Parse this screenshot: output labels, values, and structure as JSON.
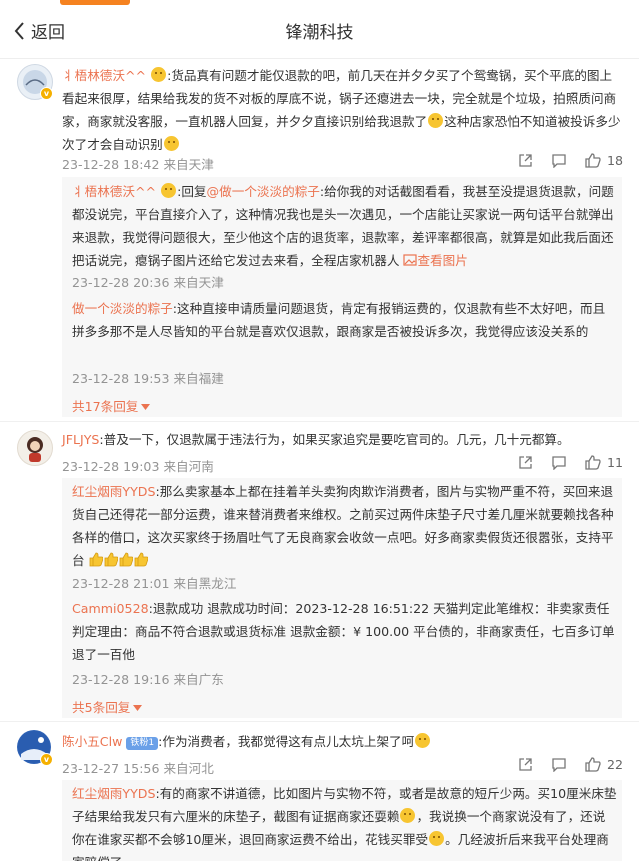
{
  "header": {
    "back_label": "返回",
    "title": "锋潮科技"
  },
  "comments": [
    {
      "user": "丬梧林德沃^^",
      "text": ":货品真有问题才能仅退款的吧，前几天在并夕夕买了个鸳鸯锅，买个平底的图上看起来很厚，结果给我发的货不对板的厚底不说，锅子还瘪进去一块，完全就是个垃圾，拍照质问商家，商家就没客服，一直机器人回复，并夕夕直接识别给我退款了",
      "text_tail": "这种店家恐怕不知道被投诉多少次了才会自动识别",
      "meta": "23-12-28 18:42 来自天津",
      "likes": "18",
      "replies": [
        {
          "user": "丬梧林德沃^^",
          "prefix": ":回复",
          "mention": "@做一个淡淡的粽子",
          "text": ":给你我的对话截图看看，我甚至没提退货退款，问题都没说完，平台直接介入了，这种情况我也是头一次遇见，一个店能让买家说一两句话平台就弹出来退款，我觉得问题很大，至少他这个店的退货率，退款率，差评率都很高，就算是如此我后面还把话说完，瘪锅子图片还给它发过去来看，全程店家机器人",
          "link": "查看图片",
          "meta": "23-12-28 20:36 来自天津"
        },
        {
          "user": "做一个淡淡的粽子",
          "text": ":这种直接申请质量问题退货，肯定有报销运费的，仅退款有些不太好吧，而且拼多多那不是人尽皆知的平台就是喜欢仅退款，跟商家是否被投诉多次，我觉得应该没关系的",
          "meta": "23-12-28 19:53 来自福建"
        }
      ],
      "more": "共17条回复"
    },
    {
      "user": "JFLJYS",
      "text": ":普及一下，仅退款属于违法行为，如果买家追究是要吃官司的。几元，几十元都算。",
      "meta": "23-12-28 19:03 来自河南",
      "likes": "11",
      "replies": [
        {
          "user": "红尘烟雨YYDS",
          "text": ":那么卖家基本上都在挂着羊头卖狗肉欺诈消费者，图片与实物严重不符，买回来退货自己还得花一部分运费，谁来替消费者来维权。之前买过两件床垫子尺寸差几厘米就要赖找各种各样的借口，这次买家终于扬眉吐气了无良商家会收敛一点吧。好多商家卖假货还很嚣张，支持平台",
          "meta": "23-12-28 21:01 来自黑龙江"
        },
        {
          "user": "Cammi0528",
          "text": ":退款成功 退款成功时间：2023-12-28 16:51:22 天猫判定此笔维权：非卖家责任 判定理由：商品不符合退款或退货标准 退款金额：¥ 100.00 平台债的，非商家责任，七百多订单退了一百他",
          "meta": "23-12-28 19:16 来自广东"
        }
      ],
      "more": "共5条回复"
    },
    {
      "user": "陈小五Clw",
      "badge": "铁粉1",
      "text": ":作为消费者，我都觉得这有点儿太坑上架了呵",
      "meta": "23-12-27 15:56 来自河北",
      "likes": "22",
      "replies": [
        {
          "user": "红尘烟雨YYDS",
          "text": ":有的商家不讲道德，比如图片与实物不符，或者是故意的短斤少两。买10厘米床垫子结果给我发只有六厘米的床垫子，截图有证据商家还耍赖",
          "text2": "，我说换一个商家说没有了，还说你在谁家买都不会够10厘米，退回商家运费不给出，花钱买罪受",
          "text3": "。几经波折后来我平台处理商家赔偿了",
          "meta": ""
        }
      ]
    }
  ],
  "colors": {
    "accent": "#f58220",
    "username": "#eb7350",
    "meta": "#939393",
    "reply_bg": "#f7f7f7",
    "badge": "#f5b000"
  }
}
